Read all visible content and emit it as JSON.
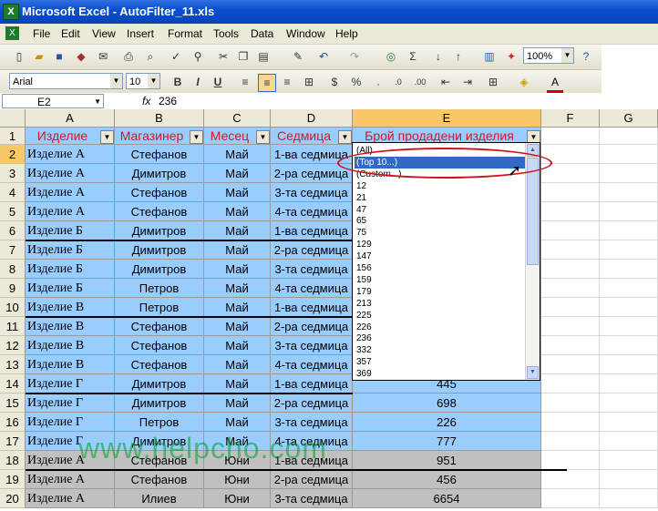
{
  "window": {
    "title": "Microsoft Excel - AutoFilter_11.xls",
    "app_icon": "X"
  },
  "menu": [
    "File",
    "Edit",
    "View",
    "Insert",
    "Format",
    "Tools",
    "Data",
    "Window",
    "Help"
  ],
  "toolbar": {
    "zoom": "100%",
    "font": "Arial",
    "size": "10",
    "bold": "B",
    "italic": "I",
    "underline": "U"
  },
  "formula_bar": {
    "cell_ref": "E2",
    "fx": "fx",
    "value": "236"
  },
  "columns": [
    "A",
    "B",
    "C",
    "D",
    "E",
    "F",
    "G"
  ],
  "headers": [
    "Изделие",
    "Магазинер",
    "Месец",
    "Седмица",
    "Брой продадени изделия"
  ],
  "rows": [
    {
      "n": "1"
    },
    {
      "n": "2",
      "a": "Изделие А",
      "b": "Стефанов",
      "c": "Май",
      "d": "1-ва седмица",
      "e": ""
    },
    {
      "n": "3",
      "a": "Изделие А",
      "b": "Димитров",
      "c": "Май",
      "d": "2-ра седмица",
      "e": ""
    },
    {
      "n": "4",
      "a": "Изделие А",
      "b": "Стефанов",
      "c": "Май",
      "d": "3-та седмица",
      "e": ""
    },
    {
      "n": "5",
      "a": "Изделие А",
      "b": "Стефанов",
      "c": "Май",
      "d": "4-та седмица",
      "e": ""
    },
    {
      "n": "6",
      "a": "Изделие Б",
      "b": "Димитров",
      "c": "Май",
      "d": "1-ва седмица",
      "e": ""
    },
    {
      "n": "7",
      "a": "Изделие Б",
      "b": "Димитров",
      "c": "Май",
      "d": "2-ра седмица",
      "e": ""
    },
    {
      "n": "8",
      "a": "Изделие Б",
      "b": "Димитров",
      "c": "Май",
      "d": "3-та седмица",
      "e": ""
    },
    {
      "n": "9",
      "a": "Изделие Б",
      "b": "Петров",
      "c": "Май",
      "d": "4-та седмица",
      "e": ""
    },
    {
      "n": "10",
      "a": "Изделие В",
      "b": "Петров",
      "c": "Май",
      "d": "1-ва седмица",
      "e": ""
    },
    {
      "n": "11",
      "a": "Изделие В",
      "b": "Стефанов",
      "c": "Май",
      "d": "2-ра седмица",
      "e": ""
    },
    {
      "n": "12",
      "a": "Изделие В",
      "b": "Стефанов",
      "c": "Май",
      "d": "3-та седмица",
      "e": ""
    },
    {
      "n": "13",
      "a": "Изделие В",
      "b": "Стефанов",
      "c": "Май",
      "d": "4-та седмица",
      "e": ""
    },
    {
      "n": "14",
      "a": "Изделие Г",
      "b": "Димитров",
      "c": "Май",
      "d": "1-ва седмица",
      "e": "445"
    },
    {
      "n": "15",
      "a": "Изделие Г",
      "b": "Димитров",
      "c": "Май",
      "d": "2-ра седмица",
      "e": "698"
    },
    {
      "n": "16",
      "a": "Изделие Г",
      "b": "Петров",
      "c": "Май",
      "d": "3-та седмица",
      "e": "226"
    },
    {
      "n": "17",
      "a": "Изделие Г",
      "b": "Димитров",
      "c": "Май",
      "d": "4-та седмица",
      "e": "777"
    },
    {
      "n": "18",
      "a": "Изделие А",
      "b": "Стефанов",
      "c": "Юни",
      "d": "1-ва седмица",
      "e": "951"
    },
    {
      "n": "19",
      "a": "Изделие А",
      "b": "Стефанов",
      "c": "Юни",
      "d": "2-ра седмица",
      "e": "456"
    },
    {
      "n": "20",
      "a": "Изделие А",
      "b": "Илиев",
      "c": "Юни",
      "d": "3-та седмица",
      "e": "6654"
    }
  ],
  "filter_options": [
    "(All)",
    "(Top 10...)",
    "(Custom...)",
    "12",
    "21",
    "47",
    "65",
    "75",
    "129",
    "147",
    "156",
    "159",
    "179",
    "213",
    "225",
    "226",
    "236",
    "332",
    "357",
    "369"
  ],
  "highlighted_option": "(Top 10...)",
  "watermark": "www.helpcho.com",
  "colors": {
    "blue_fill": "#99ccff",
    "gray_fill": "#c0c0c0",
    "header_text": "#e0141e",
    "highlight": "#316ac5"
  }
}
